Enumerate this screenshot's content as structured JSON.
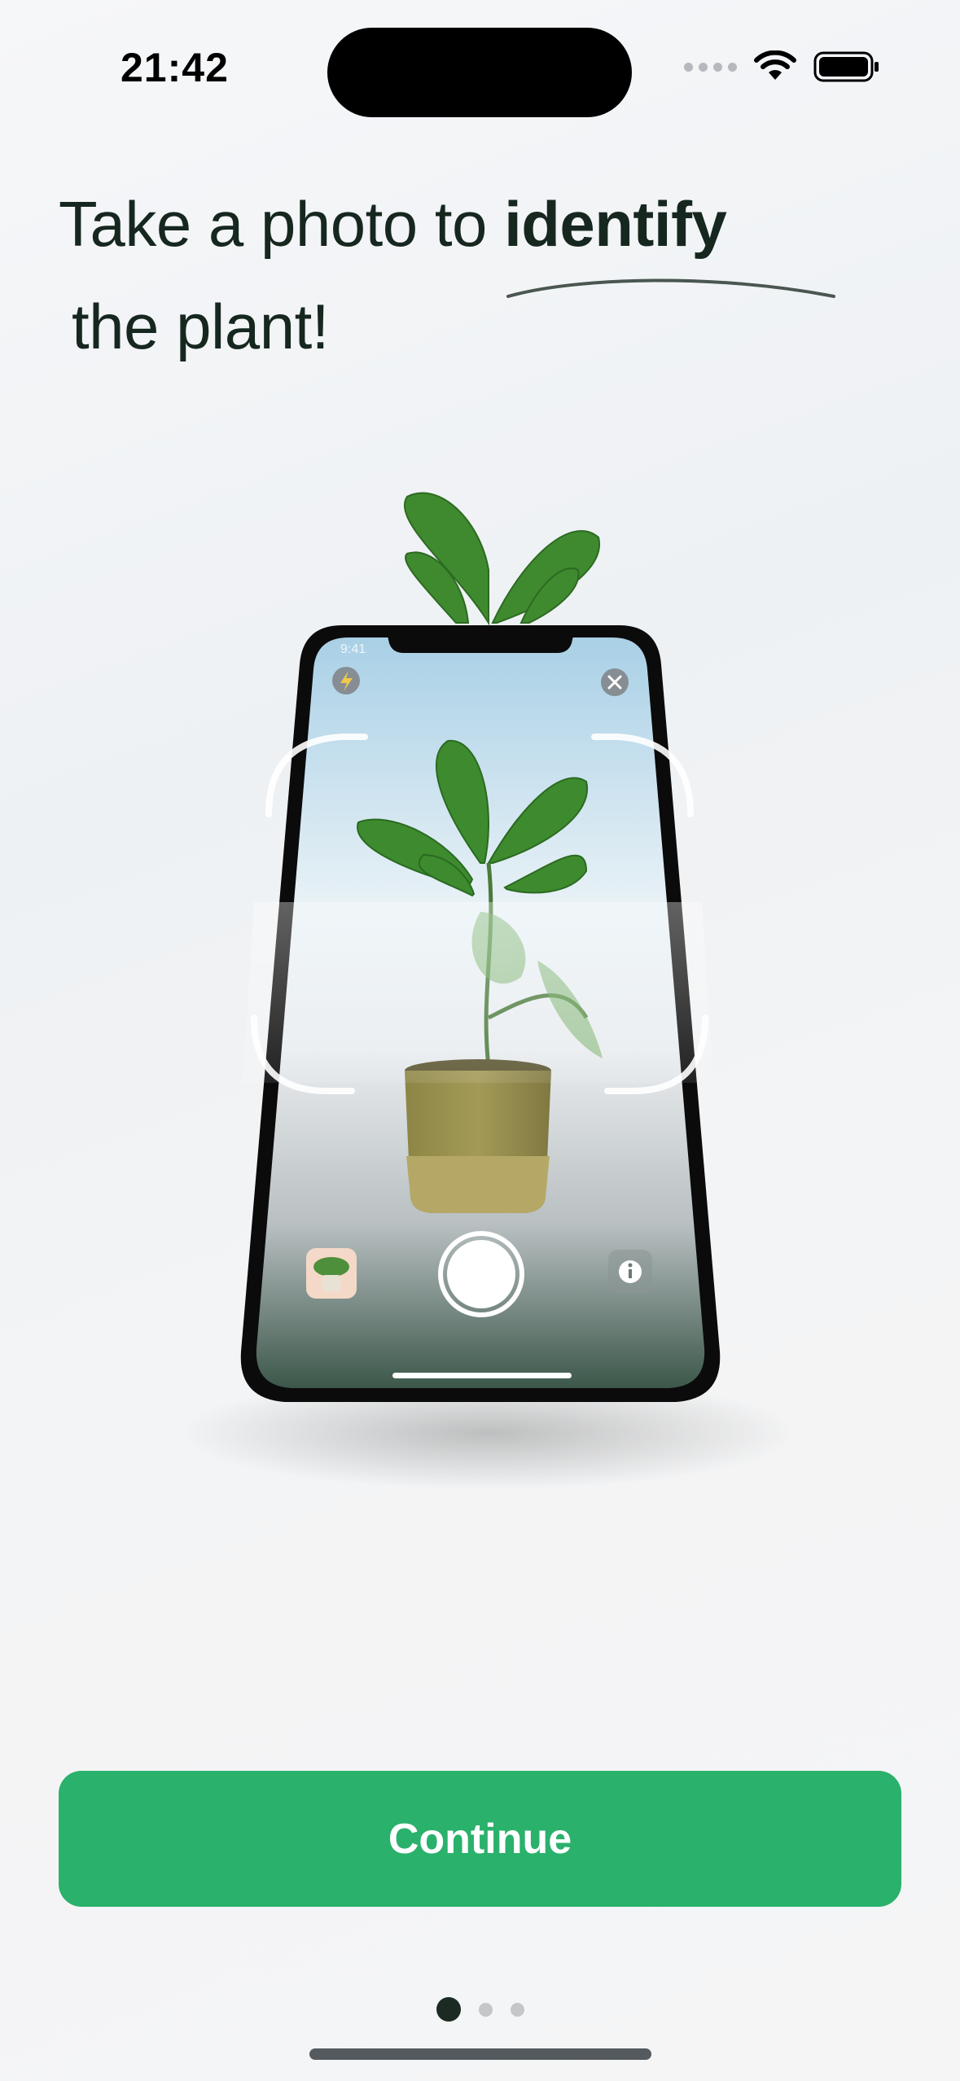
{
  "status_bar": {
    "time": "21:42"
  },
  "onboarding": {
    "headline_prefix": "Take a photo to ",
    "headline_bold": "identify",
    "headline_line2": "the plant!"
  },
  "illustration": {
    "inner_status_time": "9:41",
    "icons": [
      "flash-icon",
      "close-icon",
      "plant-thumbnail",
      "shutter-button",
      "info-icon"
    ]
  },
  "actions": {
    "continue_label": "Continue"
  },
  "pagination": {
    "total": 3,
    "current": 1
  },
  "colors": {
    "accent": "#2ab16c",
    "headline": "#16271f",
    "dot_active": "#1b2a22",
    "dot_inactive": "#c4c6c8"
  }
}
